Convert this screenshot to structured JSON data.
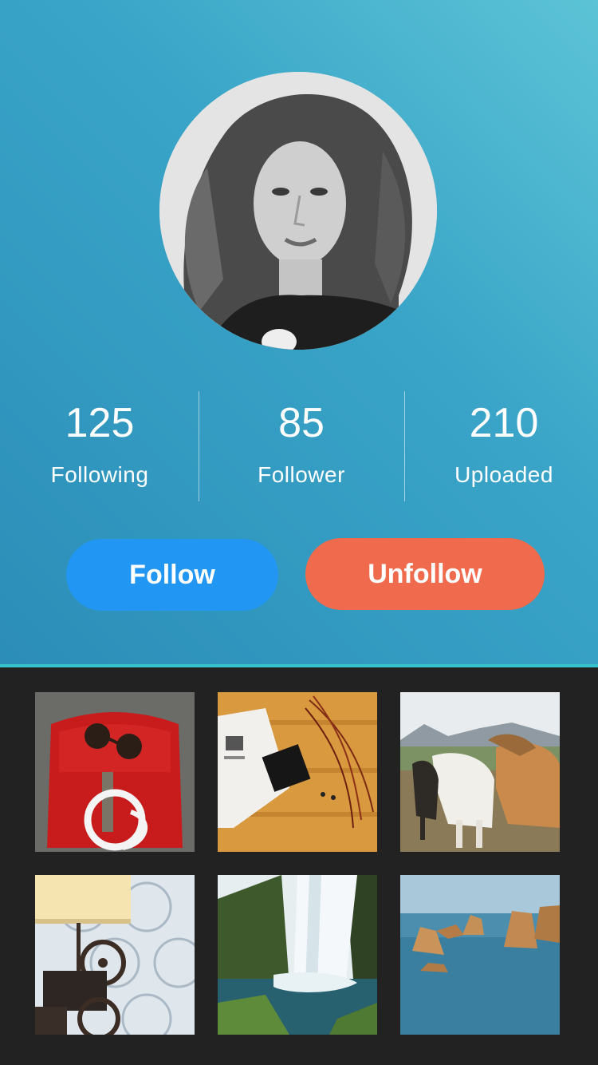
{
  "profile": {
    "avatar_alt": "profile-photo"
  },
  "stats": [
    {
      "value": "125",
      "label": "Following"
    },
    {
      "value": "85",
      "label": "Follower"
    },
    {
      "value": "210",
      "label": "Uploaded"
    }
  ],
  "actions": {
    "follow_label": "Follow",
    "unfollow_label": "Unfollow"
  },
  "colors": {
    "header_gradient_start": "#5cc3d6",
    "header_gradient_end": "#2b8db8",
    "follow_button": "#2196f3",
    "unfollow_button": "#f06a4d",
    "gallery_background": "#222222"
  },
  "gallery": {
    "photos": [
      {
        "subject": "red-backpack-sunglasses-headphones"
      },
      {
        "subject": "notebook-wallet-on-wooden-table"
      },
      {
        "subject": "horses-in-field"
      },
      {
        "subject": "lamp-and-film-projector"
      },
      {
        "subject": "waterfall"
      },
      {
        "subject": "sea-rocks"
      }
    ]
  }
}
